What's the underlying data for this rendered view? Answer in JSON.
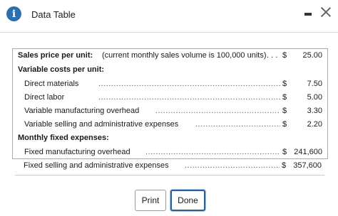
{
  "dialog": {
    "title": "Data Table"
  },
  "table": {
    "sales_price": {
      "label": "Sales price per unit:",
      "note": "(current monthly sales volume is 100,000 units)",
      "dots": ". . .",
      "currency": "$",
      "value": "25.00"
    },
    "variable_costs": {
      "header": "Variable costs per unit:",
      "rows": [
        {
          "label": "Direct materials",
          "currency": "$",
          "value": "7.50"
        },
        {
          "label": "Direct labor",
          "currency": "$",
          "value": "5.00"
        },
        {
          "label": "Variable manufacturing overhead",
          "currency": "$",
          "value": "3.30"
        },
        {
          "label": "Variable selling and administrative expenses",
          "currency": "$",
          "value": "2.20"
        }
      ]
    },
    "fixed_expenses": {
      "header": "Monthly fixed expenses:",
      "rows": [
        {
          "label": "Fixed manufacturing overhead",
          "currency": "$",
          "value": "241,600"
        },
        {
          "label": "Fixed selling and administrative expenses",
          "currency": "$",
          "value": "357,600"
        }
      ]
    }
  },
  "buttons": {
    "print": "Print",
    "done": "Done"
  },
  "icons": {
    "info": "info-icon",
    "minimize": "minimize-icon",
    "close": "close-icon"
  },
  "colors": {
    "info_icon": "#2a6fb0",
    "done_border": "#2f5f93"
  }
}
